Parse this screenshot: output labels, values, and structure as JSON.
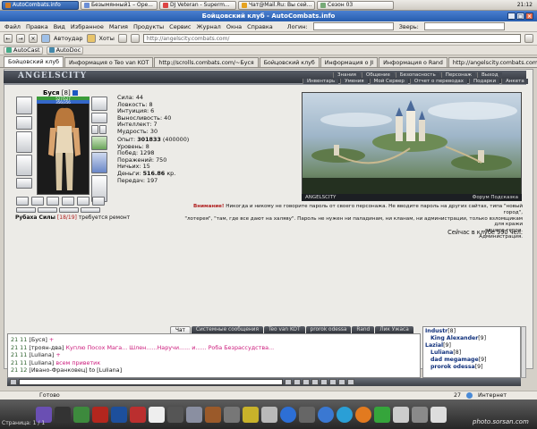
{
  "taskbar": {
    "tabs": [
      {
        "label": "AutoCombats.info",
        "active": true
      },
      {
        "label": "Безымянный1 – Оре..."
      },
      {
        "label": "DJ Veteran - Superm..."
      },
      {
        "label": "Чат@Mail.Ru: Вы сей..."
      },
      {
        "label": "Сезон 03"
      }
    ],
    "clock": "21:12"
  },
  "window": {
    "title": "Бойцовский клуб - AutoCombats.info",
    "minimize": "_",
    "maximize": "□",
    "close": "×"
  },
  "menu": {
    "items": [
      "Файл",
      "Правка",
      "Вид",
      "Избранное",
      "Магия",
      "Продукты",
      "Сервис",
      "Журнал",
      "Окна",
      "Справка"
    ],
    "login_label": "Логин:",
    "beast_label": "Зверь:"
  },
  "nav": {
    "back": "←",
    "forward": "→",
    "close": "×",
    "autoload": "Автоудар",
    "hotkeys": "Хоты",
    "address": "http://angelscity.combats.com/"
  },
  "bookmarks": {
    "items": [
      "AutoCast",
      "AutoDoc"
    ]
  },
  "page_tabs": [
    {
      "label": "Бойцовский клуб",
      "active": true
    },
    {
      "label": "Информация о Teo van KOT"
    },
    {
      "label": "http://scrolls.combats.com/~Буся"
    },
    {
      "label": "Бойцовский клуб"
    },
    {
      "label": "Информация о JI"
    },
    {
      "label": "Информация о Rand"
    },
    {
      "label": "http://angelscity.combats.com..."
    }
  ],
  "game": {
    "logo": "ANGELSCITY",
    "nav_top": [
      "Знания",
      "Общение",
      "Безопасность",
      "Персонаж",
      "Выход"
    ],
    "nav_bottom": [
      "Инвентарь",
      "Умения",
      "Мой Сервер",
      "Отчет о переводах",
      "Подарки",
      "Анкета"
    ],
    "character": {
      "name": "Буся",
      "level": "[8]",
      "hp": "527/527",
      "mp": "356/356"
    },
    "stats": [
      {
        "label": "Сила:",
        "value": "44"
      },
      {
        "label": "Ловкость:",
        "value": "8"
      },
      {
        "label": "Интуиция:",
        "value": "6"
      },
      {
        "label": "Выносливость:",
        "value": "40"
      },
      {
        "label": "Интеллект:",
        "value": "7"
      },
      {
        "label": "Мудрость:",
        "value": "30"
      }
    ],
    "stats2": [
      {
        "label": "Опыт:",
        "value": "301833",
        "extra": "(400000)"
      },
      {
        "label": "Уровень:",
        "value": "8"
      },
      {
        "label": "Побед:",
        "value": "1298"
      },
      {
        "label": "Поражений:",
        "value": "750"
      },
      {
        "label": "Ничьих:",
        "value": "15"
      },
      {
        "label": "Деньги:",
        "value": "516.86",
        "extra": "кр."
      },
      {
        "label": "Передач:",
        "value": "197"
      }
    ],
    "weapon": {
      "name": "Рубаха Силы",
      "durability": "[18/19]",
      "note": "требуется ремонт"
    },
    "banner_left": "ANGELSCITY",
    "banner_right": "Форум   Подсказка",
    "warning_title": "Внимание!",
    "warning_text1": "Никогда и никому не говорите пароль от своего персонажа. Не вводите пароль на других сайтах, типа \"новый город\",",
    "warning_text2": "\"лотерея\", \"там, где все дают на халяву\". Пароль не нужен ни паладинам, ни кланам, ни администрации, только взломщикам для кражи",
    "warning_text3": "вашего героя.",
    "warning_sign": "Администрация.",
    "online": "Сейчас в клубе 990 чел."
  },
  "chat": {
    "tabs": [
      {
        "label": "Чат",
        "active": true
      },
      {
        "label": "Системные сообщения"
      },
      {
        "label": "Teo van KOT"
      },
      {
        "label": "prorok odessa"
      },
      {
        "label": "Rand"
      },
      {
        "label": "Лик Ужаса"
      }
    ],
    "messages": [
      {
        "time": "21 11",
        "who": "[Буся]",
        "text": "+"
      },
      {
        "time": "21 11",
        "who": "[троян-два]",
        "text": "Куплю Посох Мага... Шлен......Наручи...... и...... Роба Безрассудства..."
      },
      {
        "time": "21 11",
        "who": "[Luliana]",
        "text": "+"
      },
      {
        "time": "21 11",
        "who": "[Luliana]",
        "text": "всем приветик"
      },
      {
        "time": "21 12",
        "who": "[Ивано-Франковец]",
        "text": "to [Luliana]"
      }
    ],
    "users": [
      {
        "name": "Industr",
        "level": "[8]"
      },
      {
        "name": "King Alexander",
        "level": "[9]"
      },
      {
        "name": "Lazial",
        "level": "[9]"
      },
      {
        "name": "Luliana",
        "level": "[8]"
      },
      {
        "name": "dad megamage",
        "level": "[9]"
      },
      {
        "name": "prorok odessa",
        "level": "[9]"
      }
    ]
  },
  "status": {
    "ready": "Готово",
    "zone": "Интернет",
    "zoom": "27"
  },
  "dock": {
    "pages": "Страница: 1 / 1",
    "watermark": "photo.sorsan.com"
  }
}
